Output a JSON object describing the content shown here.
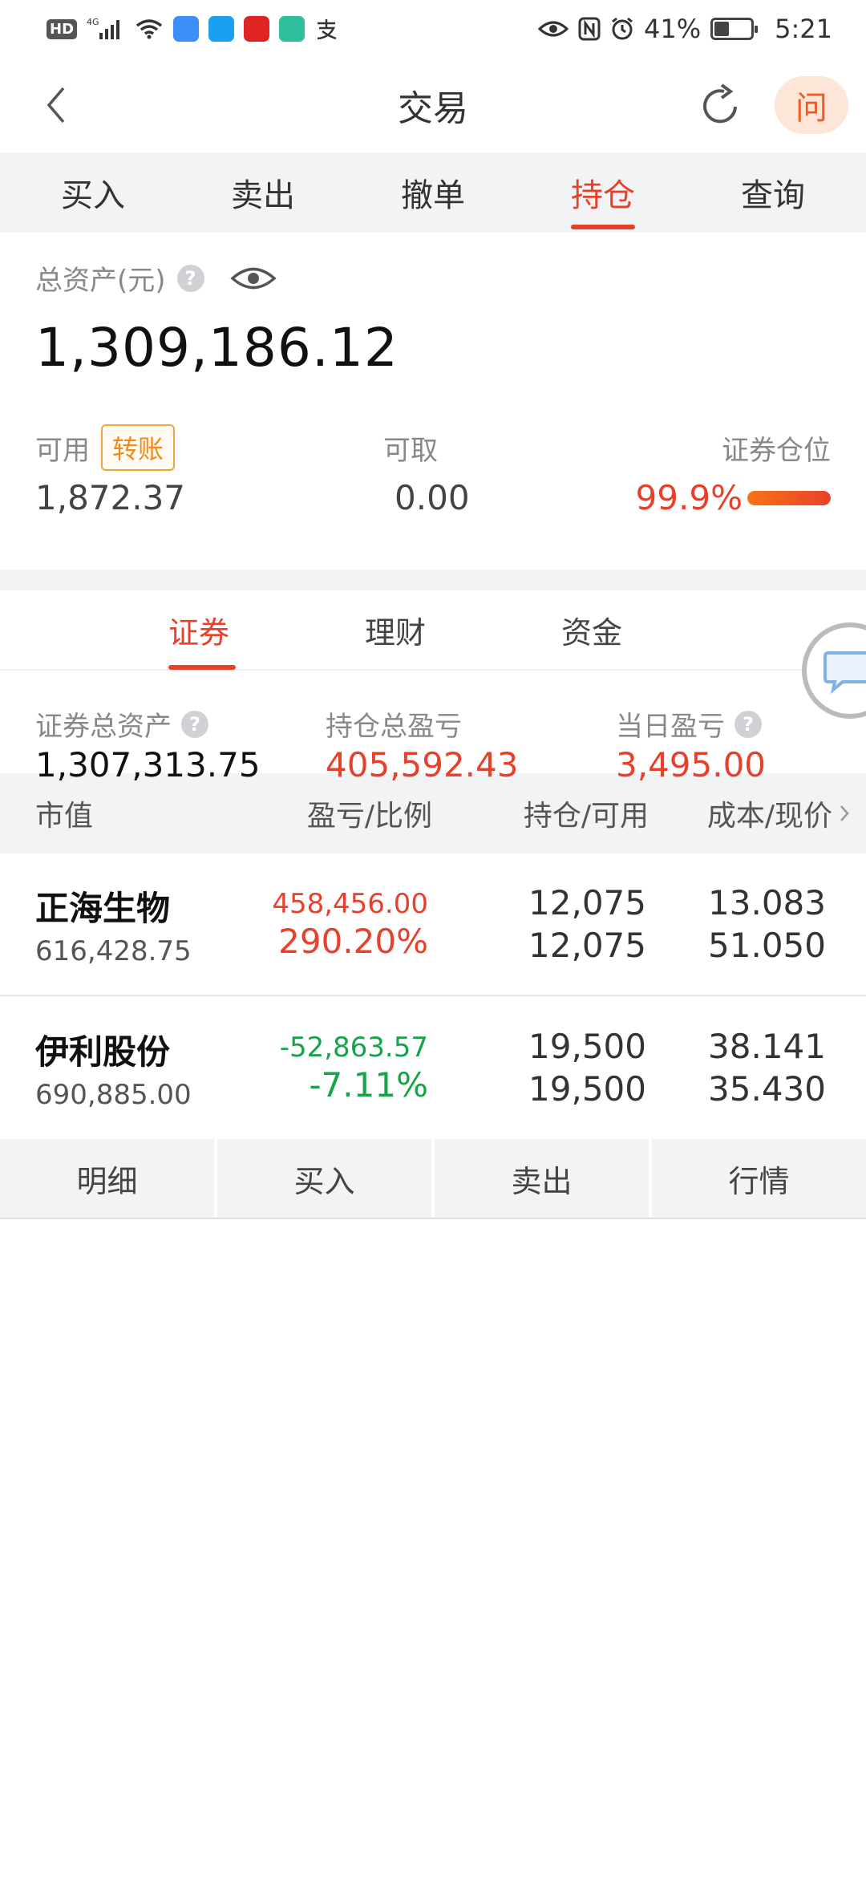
{
  "status_bar": {
    "network": "4G",
    "battery_pct": "41%",
    "battery_level": 0.41,
    "time": "5:21"
  },
  "header": {
    "title": "交易",
    "ask_label": "问"
  },
  "top_tabs": [
    {
      "label": "买入"
    },
    {
      "label": "卖出"
    },
    {
      "label": "撤单"
    },
    {
      "label": "持仓",
      "active": true
    },
    {
      "label": "查询"
    }
  ],
  "assets": {
    "total_label": "总资产(元)",
    "total_value": "1,309,186.12",
    "available_label": "可用",
    "transfer_label": "转账",
    "available_value": "1,872.37",
    "withdrawable_label": "可取",
    "withdrawable_value": "0.00",
    "position_label": "证券仓位",
    "position_value": "99.9%",
    "position_level": 0.999
  },
  "sub_tabs": [
    {
      "label": "证券",
      "active": true
    },
    {
      "label": "理财"
    },
    {
      "label": "资金"
    }
  ],
  "summary": {
    "sec_total_label": "证券总资产",
    "sec_total_value": "1,307,313.75",
    "holding_pnl_label": "持仓总盈亏",
    "holding_pnl_value": "405,592.43",
    "daily_pnl_label": "当日盈亏",
    "daily_pnl_value": "3,495.00"
  },
  "table": {
    "headers": [
      "市值",
      "盈亏/比例",
      "持仓/可用",
      "成本/现价"
    ],
    "rows": [
      {
        "name": "正海生物",
        "market_value": "616,428.75",
        "pnl": "458,456.00",
        "pnl_pct": "290.20%",
        "position": "12,075",
        "available": "12,075",
        "cost": "13.083",
        "price": "51.050"
      },
      {
        "name": "伊利股份",
        "market_value": "690,885.00",
        "pnl": "-52,863.57",
        "pnl_pct": "-7.11%",
        "position": "19,500",
        "available": "19,500",
        "cost": "38.141",
        "price": "35.430"
      }
    ],
    "row_actions": [
      "明细",
      "买入",
      "卖出",
      "行情"
    ]
  },
  "colors": {
    "accent": "#e8412b",
    "gain": "#e8412b",
    "loss": "#16a34a"
  }
}
